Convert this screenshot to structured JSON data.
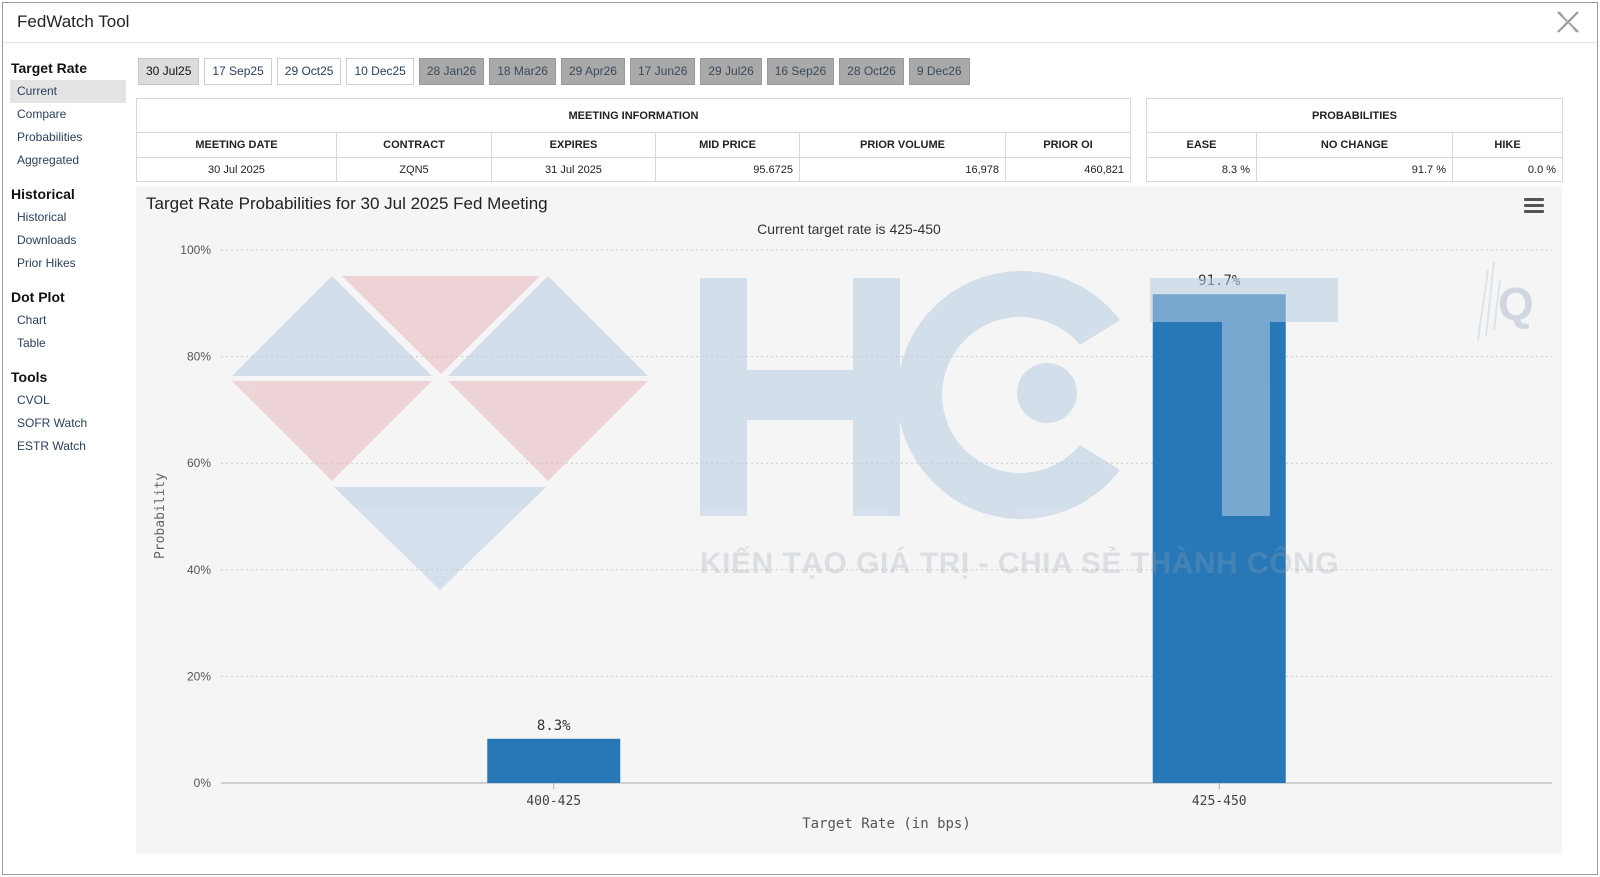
{
  "window": {
    "title": "FedWatch Tool",
    "close_icon": "close-x-icon"
  },
  "sidebar": {
    "groups": [
      {
        "heading": "Target Rate",
        "items": [
          "Current",
          "Compare",
          "Probabilities",
          "Aggregated"
        ]
      },
      {
        "heading": "Historical",
        "items": [
          "Historical",
          "Downloads",
          "Prior Hikes"
        ]
      },
      {
        "heading": "Dot Plot",
        "items": [
          "Chart",
          "Table"
        ]
      },
      {
        "heading": "Tools",
        "items": [
          "CVOL",
          "SOFR Watch",
          "ESTR Watch"
        ]
      }
    ],
    "active_item": "Current"
  },
  "tabs": [
    {
      "label": "30 Jul25",
      "state": "active"
    },
    {
      "label": "17 Sep25",
      "state": "normal"
    },
    {
      "label": "29 Oct25",
      "state": "normal"
    },
    {
      "label": "10 Dec25",
      "state": "normal"
    },
    {
      "label": "28 Jan26",
      "state": "dim"
    },
    {
      "label": "18 Mar26",
      "state": "dim"
    },
    {
      "label": "29 Apr26",
      "state": "dim"
    },
    {
      "label": "17 Jun26",
      "state": "dim"
    },
    {
      "label": "29 Jul26",
      "state": "dim"
    },
    {
      "label": "16 Sep26",
      "state": "dim"
    },
    {
      "label": "28 Oct26",
      "state": "dim"
    },
    {
      "label": "9 Dec26",
      "state": "dim"
    }
  ],
  "meeting_info": {
    "heading": "MEETING INFORMATION",
    "columns": [
      "MEETING DATE",
      "CONTRACT",
      "EXPIRES",
      "MID PRICE",
      "PRIOR VOLUME",
      "PRIOR OI"
    ],
    "row": [
      "30 Jul 2025",
      "ZQN5",
      "31 Jul 2025",
      "95.6725",
      "16,978",
      "460,821"
    ]
  },
  "probabilities": {
    "heading": "PROBABILITIES",
    "columns": [
      "EASE",
      "NO CHANGE",
      "HIKE"
    ],
    "row": [
      "8.3 %",
      "91.7 %",
      "0.0 %"
    ]
  },
  "chart_panel": {
    "title": "Target Rate Probabilities for 30 Jul 2025 Fed Meeting",
    "subtitle": "Current target rate is 425-450",
    "menu_icon": "hamburger-menu-icon"
  },
  "chart_data": {
    "type": "bar",
    "categories": [
      "400-425",
      "425-450"
    ],
    "values": [
      8.3,
      91.7
    ],
    "data_labels": [
      "8.3%",
      "91.7%"
    ],
    "xlabel": "Target Rate (in bps)",
    "ylabel": "Probability",
    "ylim": [
      0,
      100
    ],
    "yticks": [
      "0%",
      "20%",
      "40%",
      "60%",
      "80%",
      "100%"
    ],
    "grid": true,
    "bar_color": "#2878b8"
  },
  "watermark": {
    "text": "KIẾN TẠO GIÁ TRỊ - CHIA SẺ THÀNH CÔNG",
    "logo": "HCT"
  }
}
